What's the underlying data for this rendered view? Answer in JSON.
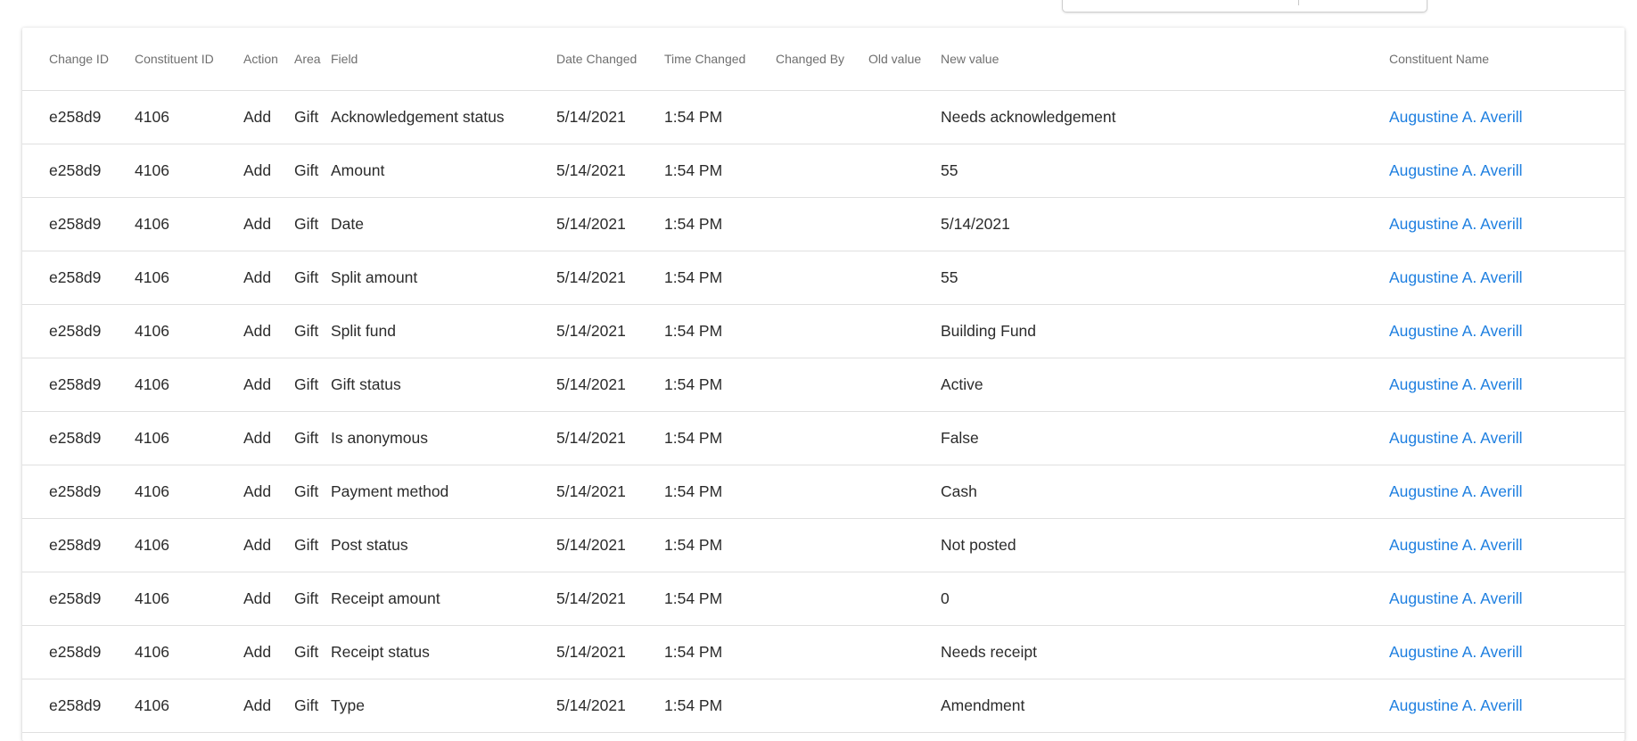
{
  "table": {
    "headers": [
      "Change ID",
      "Constituent ID",
      "Action",
      "Area",
      "Field",
      "Date Changed",
      "Time Changed",
      "Changed By",
      "Old value",
      "New value",
      "Constituent Name"
    ],
    "rows": [
      {
        "change_id": "e258d9",
        "constituent_id": "4106",
        "action": "Add",
        "area": "Gift",
        "field": "Acknowledgement status",
        "date_changed": "5/14/2021",
        "time_changed": "1:54 PM",
        "changed_by": "",
        "old_value": "",
        "new_value": "Needs acknowledgement",
        "constituent_name": "Augustine A. Averill"
      },
      {
        "change_id": "e258d9",
        "constituent_id": "4106",
        "action": "Add",
        "area": "Gift",
        "field": "Amount",
        "date_changed": "5/14/2021",
        "time_changed": "1:54 PM",
        "changed_by": "",
        "old_value": "",
        "new_value": "55",
        "constituent_name": "Augustine A. Averill"
      },
      {
        "change_id": "e258d9",
        "constituent_id": "4106",
        "action": "Add",
        "area": "Gift",
        "field": "Date",
        "date_changed": "5/14/2021",
        "time_changed": "1:54 PM",
        "changed_by": "",
        "old_value": "",
        "new_value": "5/14/2021",
        "constituent_name": "Augustine A. Averill"
      },
      {
        "change_id": "e258d9",
        "constituent_id": "4106",
        "action": "Add",
        "area": "Gift",
        "field": "Split amount",
        "date_changed": "5/14/2021",
        "time_changed": "1:54 PM",
        "changed_by": "",
        "old_value": "",
        "new_value": "55",
        "constituent_name": "Augustine A. Averill"
      },
      {
        "change_id": "e258d9",
        "constituent_id": "4106",
        "action": "Add",
        "area": "Gift",
        "field": "Split fund",
        "date_changed": "5/14/2021",
        "time_changed": "1:54 PM",
        "changed_by": "",
        "old_value": "",
        "new_value": "Building Fund",
        "constituent_name": "Augustine A. Averill"
      },
      {
        "change_id": "e258d9",
        "constituent_id": "4106",
        "action": "Add",
        "area": "Gift",
        "field": "Gift status",
        "date_changed": "5/14/2021",
        "time_changed": "1:54 PM",
        "changed_by": "",
        "old_value": "",
        "new_value": "Active",
        "constituent_name": "Augustine A. Averill"
      },
      {
        "change_id": "e258d9",
        "constituent_id": "4106",
        "action": "Add",
        "area": "Gift",
        "field": "Is anonymous",
        "date_changed": "5/14/2021",
        "time_changed": "1:54 PM",
        "changed_by": "",
        "old_value": "",
        "new_value": "False",
        "constituent_name": "Augustine A. Averill"
      },
      {
        "change_id": "e258d9",
        "constituent_id": "4106",
        "action": "Add",
        "area": "Gift",
        "field": "Payment method",
        "date_changed": "5/14/2021",
        "time_changed": "1:54 PM",
        "changed_by": "",
        "old_value": "",
        "new_value": "Cash",
        "constituent_name": "Augustine A. Averill"
      },
      {
        "change_id": "e258d9",
        "constituent_id": "4106",
        "action": "Add",
        "area": "Gift",
        "field": "Post status",
        "date_changed": "5/14/2021",
        "time_changed": "1:54 PM",
        "changed_by": "",
        "old_value": "",
        "new_value": "Not posted",
        "constituent_name": "Augustine A. Averill"
      },
      {
        "change_id": "e258d9",
        "constituent_id": "4106",
        "action": "Add",
        "area": "Gift",
        "field": "Receipt amount",
        "date_changed": "5/14/2021",
        "time_changed": "1:54 PM",
        "changed_by": "",
        "old_value": "",
        "new_value": "0",
        "constituent_name": "Augustine A. Averill"
      },
      {
        "change_id": "e258d9",
        "constituent_id": "4106",
        "action": "Add",
        "area": "Gift",
        "field": "Receipt status",
        "date_changed": "5/14/2021",
        "time_changed": "1:54 PM",
        "changed_by": "",
        "old_value": "",
        "new_value": "Needs receipt",
        "constituent_name": "Augustine A. Averill"
      },
      {
        "change_id": "e258d9",
        "constituent_id": "4106",
        "action": "Add",
        "area": "Gift",
        "field": "Type",
        "date_changed": "5/14/2021",
        "time_changed": "1:54 PM",
        "changed_by": "",
        "old_value": "",
        "new_value": "Amendment",
        "constituent_name": "Augustine A. Averill"
      }
    ]
  }
}
